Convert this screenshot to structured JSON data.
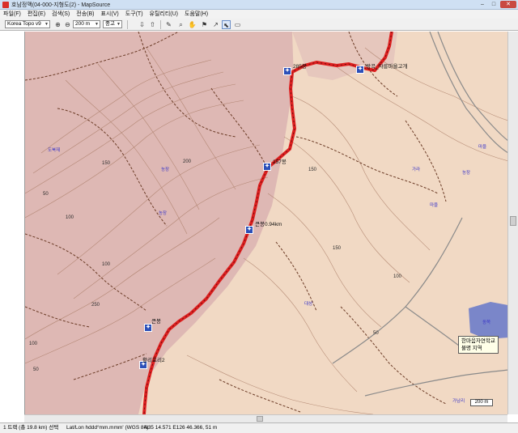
{
  "window": {
    "title": "호남정맥(04-000-지형도(2) - MapSource",
    "minimize": "–",
    "maximize": "□",
    "close": "✕"
  },
  "menu": [
    "파일(F)",
    "편집(E)",
    "검색(S)",
    "전송(B)",
    "표시(V)",
    "도구(T)",
    "유틸리티(U)",
    "도움말(H)"
  ],
  "toolbar": {
    "map_product": "Korea Topo v9",
    "zoom_scale": "200 m",
    "detail_level": "중고"
  },
  "map": {
    "waypoints": [
      {
        "label": "285봉"
      },
      {
        "label": "왕곡_자릉마을고개"
      },
      {
        "label": "257봉"
      },
      {
        "label": "큰봉0.94km"
      },
      {
        "label": "큰봉"
      },
      {
        "label": "활리포리2"
      }
    ],
    "contour_labels": [
      "50",
      "100",
      "150",
      "200",
      "250",
      "100",
      "50",
      "100",
      "150",
      "50",
      "100",
      "150"
    ],
    "poi_labels": [
      "도북재",
      "농장",
      "농장",
      "가라",
      "농장",
      "대성",
      "마을",
      "마을",
      "가남리",
      "동쪽"
    ],
    "popup": {
      "line1": "한마음자연학교",
      "line2": "불명 지역"
    },
    "scale": "200 m",
    "colors": {
      "track": "#dd1f1f",
      "mountain": "#dcb6b3",
      "land": "#f1d9c4",
      "contour": "#9b6b55",
      "trail": "#6b3b26",
      "water": "#7a86c9",
      "waypoint": "#2b4fb8"
    }
  },
  "status": {
    "track_info": "1 트랙 (총 19.8 km) 선택",
    "position_format": "Lat/Lon hddd°mm.mmm' (WGS 84)",
    "coordinates": "N35 14.571 E126 46.366, 51 m"
  }
}
